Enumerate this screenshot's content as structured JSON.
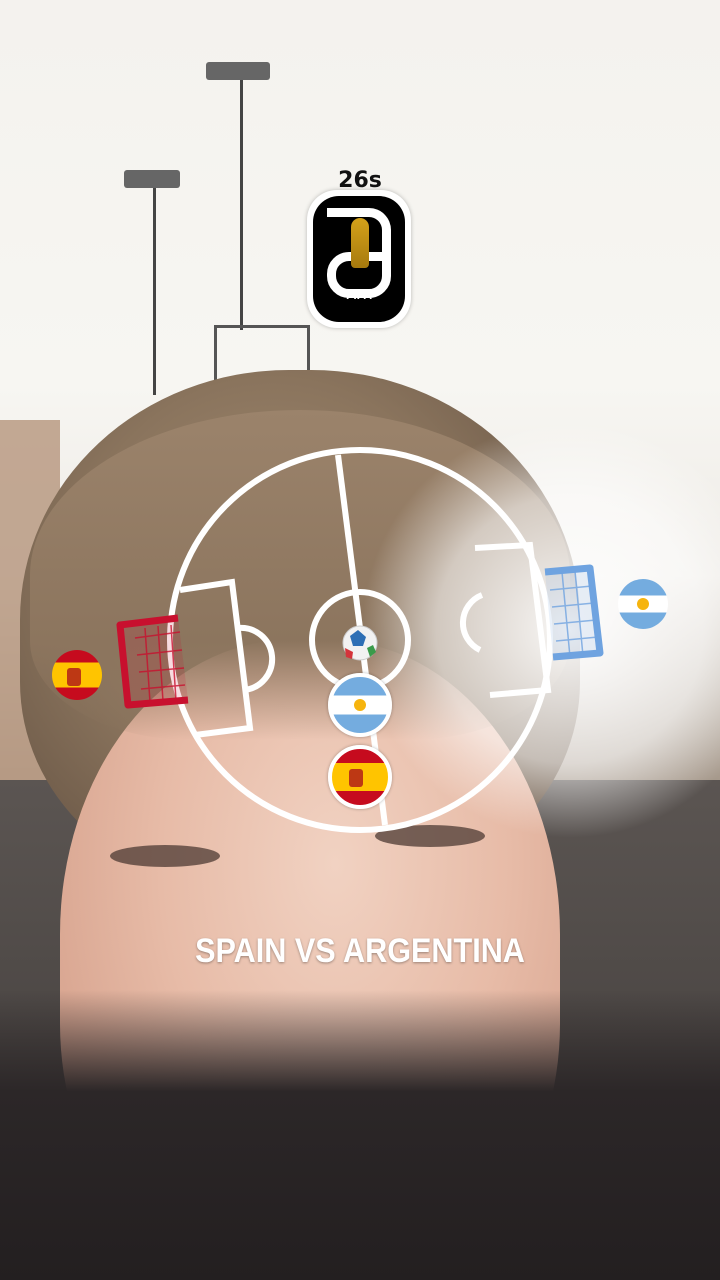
{
  "hud": {
    "timer": "26s",
    "logo_text": "FIFA",
    "logo_icon": "fifa-world-cup-2026-logo"
  },
  "match": {
    "title": "SPAIN VS ARGENTINA",
    "left_team": "Spain",
    "right_team": "Argentina"
  },
  "pitch": {
    "line_color": "#ffffff",
    "left_goal_color": "#c8102e",
    "right_goal_color": "#6fa3e0",
    "ball_icon": "soccer-ball-icon"
  },
  "colors": {
    "spain_red": "#c60b1e",
    "spain_yellow": "#ffc400",
    "argentina_blue": "#74acdf",
    "argentina_sun": "#f6b40e"
  }
}
